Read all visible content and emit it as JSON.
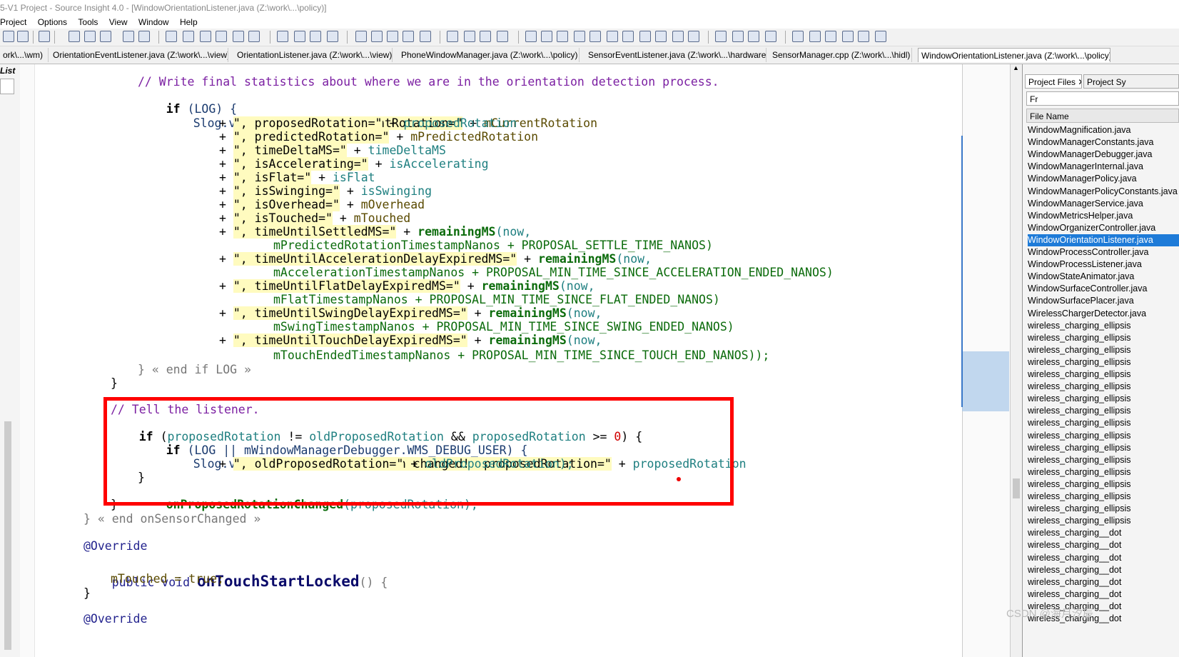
{
  "window": {
    "title": "5-V1 Project - Source Insight 4.0 - [WindowOrientationListener.java (Z:\\work\\...\\policy)]"
  },
  "menu": [
    "Project",
    "Options",
    "Tools",
    "View",
    "Window",
    "Help"
  ],
  "tabs": [
    {
      "label": "ork\\...\\wm)",
      "active": false
    },
    {
      "label": "OrientationEventListener.java (Z:\\work\\...\\view)",
      "active": false
    },
    {
      "label": "OrientationListener.java (Z:\\work\\...\\view)",
      "active": false
    },
    {
      "label": "PhoneWindowManager.java (Z:\\work\\...\\policy)",
      "active": false
    },
    {
      "label": "SensorEventListener.java (Z:\\work\\...\\hardware)",
      "active": false
    },
    {
      "label": "SensorManager.cpp (Z:\\work\\...\\hidl)",
      "active": false
    },
    {
      "label": "WindowOrientationListener.java (Z:\\work\\...\\policy)",
      "active": true
    }
  ],
  "left_panel_label": "List",
  "code": {
    "comment_stats": "// Write final statistics about where we are in the orientation detection process.",
    "if_log": "if",
    "log_cond": "(LOG) {",
    "slog1": "Slog.v(TAG, ",
    "s_result": "\"Result: currentRotation=\"",
    "plus": "+",
    "v_currentRotation": "mCurrentRotation",
    "s_proposed": "\", proposedRotation=\"",
    "v_proposed": "proposedRotation",
    "s_predicted": "\", predictedRotation=\"",
    "v_predicted": "mPredictedRotation",
    "s_timeDelta": "\", timeDeltaMS=\"",
    "v_timeDelta": "timeDeltaMS",
    "s_isAccel": "\", isAccelerating=\"",
    "v_isAccel": "isAccelerating",
    "s_isFlat": "\", isFlat=\"",
    "v_isFlat": "isFlat",
    "s_isSwinging": "\", isSwinging=\"",
    "v_isSwinging": "isSwinging",
    "s_isOverhead": "\", isOverhead=\"",
    "v_isOverhead": "mOverhead",
    "s_isTouched": "\", isTouched=\"",
    "v_isTouched": "mTouched",
    "s_settled": "\", timeUntilSettledMS=\"",
    "fn_remaining": "remainingMS",
    "now_open": "(now,",
    "settled_cont": "mPredictedRotationTimestampNanos + PROPOSAL_SETTLE_TIME_NANOS)",
    "s_accelDelay": "\", timeUntilAccelerationDelayExpiredMS=\"",
    "accel_cont": "mAccelerationTimestampNanos + PROPOSAL_MIN_TIME_SINCE_ACCELERATION_ENDED_NANOS)",
    "s_flatDelay": "\", timeUntilFlatDelayExpiredMS=\"",
    "flat_cont": "mFlatTimestampNanos + PROPOSAL_MIN_TIME_SINCE_FLAT_ENDED_NANOS)",
    "s_swingDelay": "\", timeUntilSwingDelayExpiredMS=\"",
    "swing_cont": "mSwingTimestampNanos + PROPOSAL_MIN_TIME_SINCE_SWING_ENDED_NANOS)",
    "s_touchDelay": "\", timeUntilTouchDelayExpiredMS=\"",
    "touch_cont": "mTouchEndedTimestampNanos + PROPOSAL_MIN_TIME_SINCE_TOUCH_END_NANOS));",
    "end_if_log": "} « end if LOG »",
    "close_brace": "}",
    "comment_tell": "// Tell the listener.",
    "if2_kw": "if",
    "if2_open": "(",
    "if2_a": "proposedRotation",
    "if2_neq": " != ",
    "if2_b": "oldProposedRotation",
    "if2_and": " && ",
    "if2_c": "proposedRotation",
    "if2_ge": " >= ",
    "if2_zero": "0",
    "if2_close": ") {",
    "if3_kw": "if",
    "if3_cond": "(LOG || mWindowManagerDebugger.WMS_DEBUG_USER) {",
    "slog2": "Slog.v(TAG, ",
    "s_changed": "\"Proposed rotation changed!  proposedRotation=\"",
    "v_prop2": "proposedRotation",
    "s_oldprop": "\", oldProposedRotation=\"",
    "v_oldprop": "oldProposedRotation);",
    "call_changed": "onProposedRotationChanged",
    "call_arg": "(proposedRotation);",
    "end_sensor": "} « end onSensorChanged »",
    "override1": "@Override",
    "pub_void": "public void ",
    "fn_touchStart": "onTouchStartLocked",
    "parens": "() {",
    "touched_assign": "mTouched = true;",
    "override2": "@Override"
  },
  "right_panel": {
    "tab_project_files": "Project Files",
    "tab_project_symbols": "Project Sy",
    "filter_value": "Fr",
    "column_header": "File Name",
    "files": [
      "WindowMagnification.java",
      "WindowManagerConstants.java",
      "WindowManagerDebugger.java",
      "WindowManagerInternal.java",
      "WindowManagerPolicy.java",
      "WindowManagerPolicyConstants.java",
      "WindowManagerService.java",
      "WindowMetricsHelper.java",
      "WindowOrganizerController.java",
      "WindowOrientationListener.java",
      "WindowProcessController.java",
      "WindowProcessListener.java",
      "WindowStateAnimator.java",
      "WindowSurfaceController.java",
      "WindowSurfacePlacer.java",
      "WirelessChargerDetector.java",
      "wireless_charging_ellipsis",
      "wireless_charging_ellipsis",
      "wireless_charging_ellipsis",
      "wireless_charging_ellipsis",
      "wireless_charging_ellipsis",
      "wireless_charging_ellipsis",
      "wireless_charging_ellipsis",
      "wireless_charging_ellipsis",
      "wireless_charging_ellipsis",
      "wireless_charging_ellipsis",
      "wireless_charging_ellipsis",
      "wireless_charging_ellipsis",
      "wireless_charging_ellipsis",
      "wireless_charging_ellipsis",
      "wireless_charging_ellipsis",
      "wireless_charging_ellipsis",
      "wireless_charging_ellipsis",
      "wireless_charging__dot",
      "wireless_charging__dot",
      "wireless_charging__dot",
      "wireless_charging__dot",
      "wireless_charging__dot",
      "wireless_charging__dot",
      "wireless_charging__dot",
      "wireless_charging__dot"
    ],
    "selected_index": 9
  },
  "watermark": "CSDN @海月汐辰",
  "colors": {
    "highlight_box": "#ff0000",
    "selection": "#1e7bd8",
    "string_bg": "#fffbbf"
  }
}
